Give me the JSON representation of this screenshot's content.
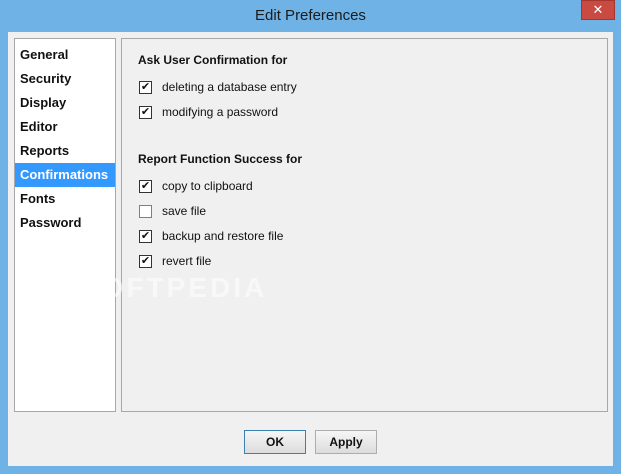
{
  "window": {
    "title": "Edit Preferences",
    "close_glyph": "✕"
  },
  "sidebar": {
    "items": [
      {
        "label": "General"
      },
      {
        "label": "Security"
      },
      {
        "label": "Display"
      },
      {
        "label": "Editor"
      },
      {
        "label": "Reports"
      },
      {
        "label": "Confirmations",
        "selected": true
      },
      {
        "label": "Fonts"
      },
      {
        "label": "Password"
      }
    ]
  },
  "confirmations": {
    "ask_title": "Ask User Confirmation for",
    "ask_options": [
      {
        "label": "deleting a database entry",
        "checked": true
      },
      {
        "label": "modifying a password",
        "checked": true
      }
    ],
    "report_title": "Report Function Success for",
    "report_options": [
      {
        "label": "copy to clipboard",
        "checked": true
      },
      {
        "label": "save file",
        "checked": false
      },
      {
        "label": "backup and restore file",
        "checked": true
      },
      {
        "label": "revert file",
        "checked": true
      }
    ]
  },
  "watermark": "SOFTPEDIA",
  "buttons": {
    "ok": "OK",
    "apply": "Apply"
  },
  "colors": {
    "title_bar": "#6fb2e6",
    "selection": "#3399ff",
    "close": "#c94a41"
  }
}
